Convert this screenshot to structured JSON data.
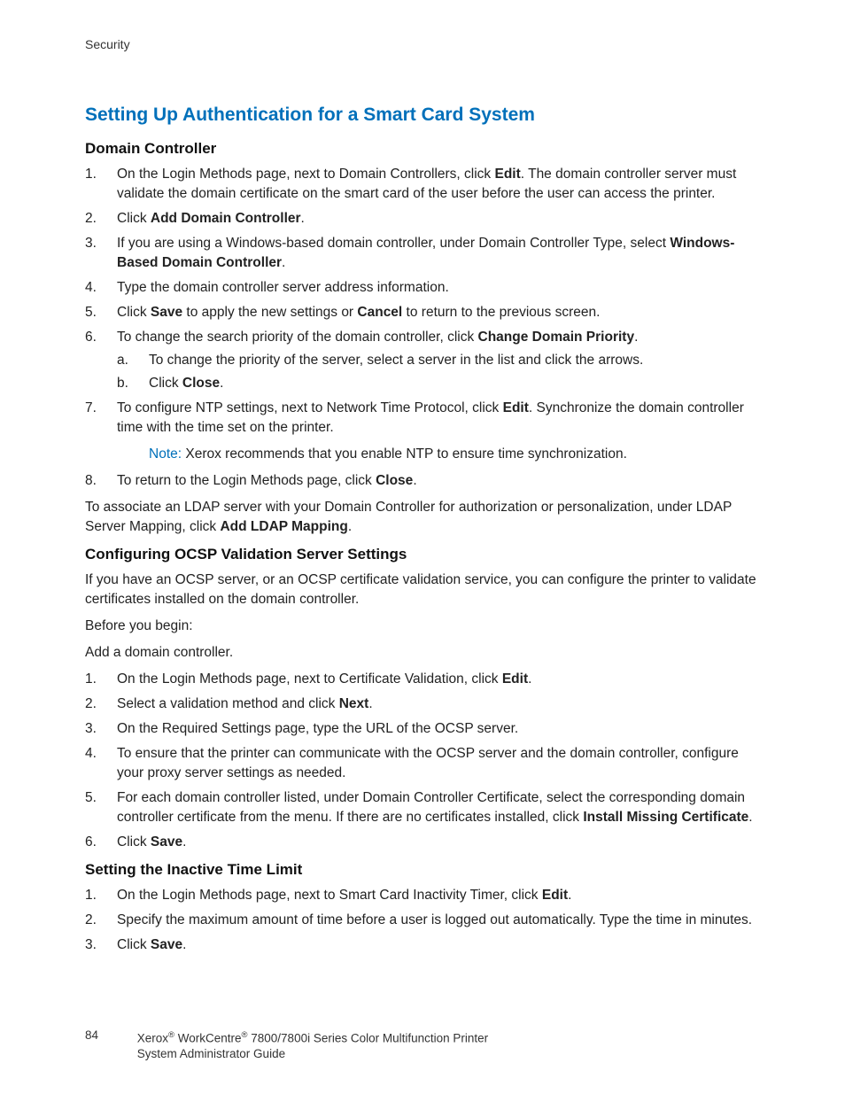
{
  "header": {
    "breadcrumb": "Security"
  },
  "title": "Setting Up Authentication for a Smart Card System",
  "sectionA": {
    "heading": "Domain Controller",
    "items": {
      "i1_pre": "On the Login Methods page, next to Domain Controllers, click ",
      "i1_b1": "Edit",
      "i1_post": ". The domain controller server must validate the domain certificate on the smart card of the user before the user can access the printer.",
      "i2_pre": "Click ",
      "i2_b1": "Add Domain Controller",
      "i2_post": ".",
      "i3_pre": "If you are using a Windows-based domain controller, under Domain Controller Type, select ",
      "i3_b1": "Windows-Based Domain Controller",
      "i3_post": ".",
      "i4": "Type the domain controller server address information.",
      "i5_pre": "Click ",
      "i5_b1": "Save",
      "i5_mid": " to apply the new settings or ",
      "i5_b2": "Cancel",
      "i5_post": " to return to the previous screen.",
      "i6_pre": "To change the search priority of the domain controller, click ",
      "i6_b1": "Change Domain Priority",
      "i6_post": ".",
      "i6a": "To change the priority of the server, select a server in the list and click the arrows.",
      "i6b_pre": "Click ",
      "i6b_b1": "Close",
      "i6b_post": ".",
      "i7_pre": "To configure NTP settings, next to Network Time Protocol, click ",
      "i7_b1": "Edit",
      "i7_post": ". Synchronize the domain controller time with the time set on the printer.",
      "note_label": "Note: ",
      "note_text": "Xerox recommends that you enable NTP to ensure time synchronization.",
      "i8_pre": "To return to the Login Methods page, click ",
      "i8_b1": "Close",
      "i8_post": "."
    },
    "para_pre": "To associate an LDAP server with your Domain Controller for authorization or personalization, under LDAP Server Mapping, click ",
    "para_b1": "Add LDAP Mapping",
    "para_post": "."
  },
  "sectionB": {
    "heading": "Configuring OCSP Validation Server Settings",
    "p1": "If you have an OCSP server, or an OCSP certificate validation service, you can configure the printer to validate certificates installed on the domain controller.",
    "p2": "Before you begin:",
    "p3": "Add a domain controller.",
    "items": {
      "i1_pre": "On the Login Methods page, next to Certificate Validation, click ",
      "i1_b1": "Edit",
      "i1_post": ".",
      "i2_pre": "Select a validation method and click ",
      "i2_b1": "Next",
      "i2_post": ".",
      "i3": "On the Required Settings page, type the URL of the OCSP server.",
      "i4": "To ensure that the printer can communicate with the OCSP server and the domain controller, configure your proxy server settings as needed.",
      "i5_pre": "For each domain controller listed, under Domain Controller Certificate, select the corresponding domain controller certificate from the menu. If there are no certificates installed, click ",
      "i5_b1": "Install Missing Certificate",
      "i5_post": ".",
      "i6_pre": "Click ",
      "i6_b1": "Save",
      "i6_post": "."
    }
  },
  "sectionC": {
    "heading": "Setting the Inactive Time Limit",
    "items": {
      "i1_pre": "On the Login Methods page, next to Smart Card Inactivity Timer, click ",
      "i1_b1": "Edit",
      "i1_post": ".",
      "i2": "Specify the maximum amount of time before a user is logged out automatically. Type the time in minutes.",
      "i3_pre": "Click ",
      "i3_b1": "Save",
      "i3_post": "."
    }
  },
  "footer": {
    "page": "84",
    "line1_a": "Xerox",
    "line1_b": " WorkCentre",
    "line1_c": " 7800/7800i Series Color Multifunction Printer",
    "line2": "System Administrator Guide"
  }
}
